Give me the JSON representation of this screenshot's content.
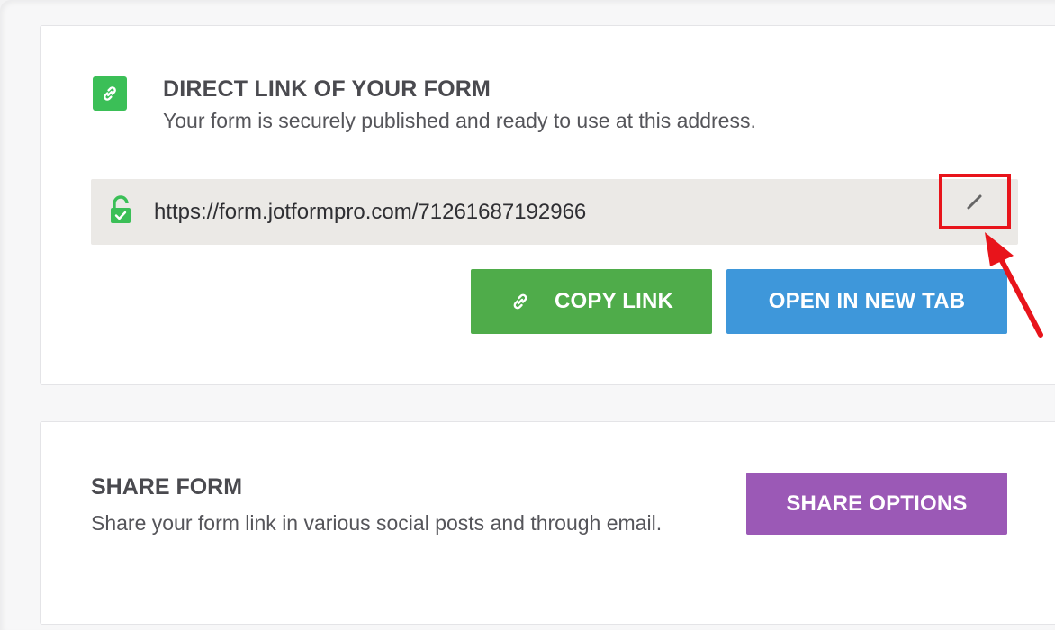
{
  "direct_link": {
    "title": "DIRECT LINK OF YOUR FORM",
    "description": "Your form is securely published and ready to use at this address.",
    "url": "https://form.jotformpro.com/71261687192966",
    "copy_label": "COPY LINK",
    "open_label": "OPEN IN NEW TAB"
  },
  "share": {
    "title": "SHARE FORM",
    "description": "Share your form link in various social posts and through email.",
    "button_label": "SHARE OPTIONS"
  },
  "colors": {
    "green": "#3bbf57",
    "copy_green": "#4fac4a",
    "blue": "#3e97da",
    "purple": "#9b59b6",
    "highlight_red": "#e8141b"
  },
  "icons": {
    "section": "link-icon",
    "url": "lock-icon",
    "edit": "pencil-icon",
    "copy": "link-icon"
  }
}
